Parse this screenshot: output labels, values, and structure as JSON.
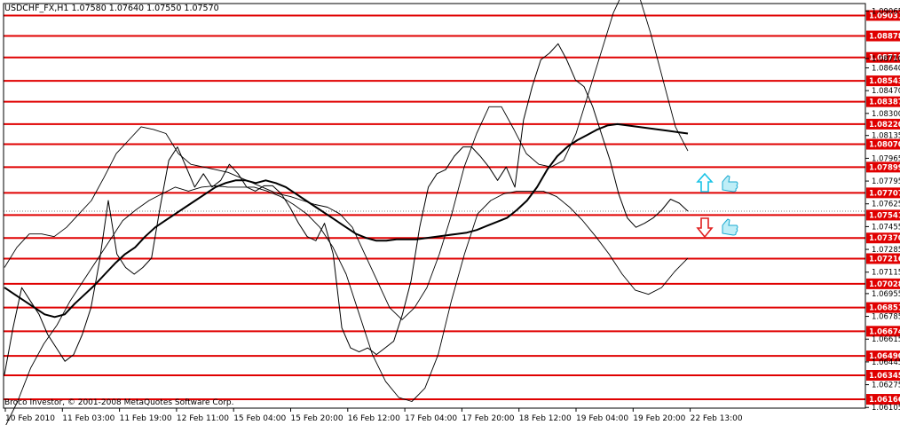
{
  "chart_data": {
    "type": "line",
    "title": "USDCHF_FX,H1  1.07580 1.07640 1.07550 1.07570",
    "watermark": "Broco Investor, © 2001-2008 MetaQuotes Software Corp.",
    "ylim": [
      1.061,
      1.0912
    ],
    "x_labels": [
      "10 Feb 2010",
      "11 Feb 03:00",
      "11 Feb 19:00",
      "12 Feb 11:00",
      "15 Feb 04:00",
      "15 Feb 20:00",
      "16 Feb 12:00",
      "17 Feb 04:00",
      "17 Feb 20:00",
      "18 Feb 12:00",
      "19 Feb 04:00",
      "19 Feb 20:00",
      "22 Feb 13:00"
    ],
    "y_ticks": [
      "1.09065",
      "1.08710",
      "1.08640",
      "1.08470",
      "1.08300",
      "1.08135",
      "1.07965",
      "1.07795",
      "1.07625",
      "1.07455",
      "1.07285",
      "1.07115",
      "1.06955",
      "1.06785",
      "1.06615",
      "1.06445",
      "1.06275",
      "1.06105"
    ],
    "levels": [
      {
        "label": "1.09031",
        "value": 1.09031
      },
      {
        "label": "1.08878",
        "value": 1.08878
      },
      {
        "label": "1.08718",
        "value": 1.08718
      },
      {
        "label": "1.08543",
        "value": 1.08543
      },
      {
        "label": "1.08387",
        "value": 1.08387
      },
      {
        "label": "1.08220",
        "value": 1.0822
      },
      {
        "label": "1.08070",
        "value": 1.0807
      },
      {
        "label": "1.07899",
        "value": 1.07899
      },
      {
        "label": "1.07707",
        "value": 1.07707
      },
      {
        "label": "1.07541",
        "value": 1.07541
      },
      {
        "label": "1.07370",
        "value": 1.0737
      },
      {
        "label": "1.07216",
        "value": 1.07216
      },
      {
        "label": "1.07028",
        "value": 1.07028
      },
      {
        "label": "1.06851",
        "value": 1.06851
      },
      {
        "label": "1.06674",
        "value": 1.06674
      },
      {
        "label": "1.06490",
        "value": 1.0649
      },
      {
        "label": "1.06345",
        "value": 1.06345
      },
      {
        "label": "1.06166",
        "value": 1.06166
      }
    ],
    "current_price": 1.0757,
    "series": [
      {
        "values": [
          1.0635,
          1.067,
          1.07,
          1.069,
          1.068,
          1.0665,
          1.0655,
          1.0645,
          1.065,
          1.0665,
          1.0685,
          1.072,
          1.0765,
          1.0725,
          1.0715,
          1.071,
          1.0715,
          1.0722,
          1.076,
          1.0795,
          1.0805,
          1.079,
          1.0775,
          1.0785,
          1.0775,
          1.078,
          1.0792,
          1.0785,
          1.0775,
          1.0772,
          1.0776,
          1.0776,
          1.077,
          1.076,
          1.0748,
          1.0738,
          1.0735,
          1.0748,
          1.0725,
          1.067,
          1.0655,
          1.0652,
          1.0655,
          1.065,
          1.0655,
          1.066,
          1.068,
          1.0705,
          1.0745,
          1.0775,
          1.0785,
          1.0788,
          1.0798,
          1.0805,
          1.0805,
          1.0798,
          1.079,
          1.078,
          1.079,
          1.0775,
          1.0825,
          1.085,
          1.087,
          1.0875,
          1.0882,
          1.087,
          1.0855,
          1.085,
          1.0835,
          1.0815,
          1.0795,
          1.077,
          1.0752,
          1.0745,
          1.0748,
          1.0752,
          1.0758,
          1.0766,
          1.0763,
          1.0757
        ]
      },
      {
        "values": [
          1.07,
          1.0695,
          1.069,
          1.0685,
          1.068,
          1.0678,
          1.068,
          1.0688,
          1.0695,
          1.0702,
          1.071,
          1.0718,
          1.0725,
          1.073,
          1.0738,
          1.0745,
          1.075,
          1.0755,
          1.076,
          1.0765,
          1.077,
          1.0775,
          1.0778,
          1.078,
          1.078,
          1.0778,
          1.078,
          1.0778,
          1.0775,
          1.077,
          1.0765,
          1.076,
          1.0755,
          1.075,
          1.0745,
          1.074,
          1.0737,
          1.0735,
          1.0735,
          1.0736,
          1.0736,
          1.0736,
          1.0737,
          1.0738,
          1.0739,
          1.074,
          1.0741,
          1.0743,
          1.0746,
          1.0749,
          1.0752,
          1.0758,
          1.0765,
          1.0775,
          1.0788,
          1.0798,
          1.0805,
          1.081,
          1.0814,
          1.0818,
          1.0821,
          1.0822,
          1.0821,
          1.082,
          1.0819,
          1.0818,
          1.0817,
          1.0816,
          1.0815
        ]
      },
      {
        "values": [
          1.0715,
          1.073,
          1.074,
          1.074,
          1.0738,
          1.0745,
          1.0755,
          1.0765,
          1.0782,
          1.08,
          1.081,
          1.082,
          1.0818,
          1.0815,
          1.08,
          1.0792,
          1.079,
          1.0788,
          1.0786,
          1.0782,
          1.0778,
          1.0774,
          1.077,
          1.0768,
          1.0765,
          1.0762,
          1.076,
          1.0755,
          1.0745,
          1.0725,
          1.0705,
          1.0685,
          1.0676,
          1.0685,
          1.07,
          1.0725,
          1.0755,
          1.079,
          1.0815,
          1.0835,
          1.0835,
          1.0818,
          1.08,
          1.0792,
          1.079,
          1.0795,
          1.0815,
          1.0845,
          1.0875,
          1.0905,
          1.0925,
          1.092,
          1.089,
          1.0855,
          1.082,
          1.0802
        ]
      },
      {
        "values": [
          1.0595,
          1.0615,
          1.064,
          1.0658,
          1.0672,
          1.069,
          1.0705,
          1.072,
          1.0735,
          1.075,
          1.0758,
          1.0765,
          1.077,
          1.0775,
          1.0772,
          1.0775,
          1.0776,
          1.0775,
          1.0775,
          1.0775,
          1.0772,
          1.0768,
          1.0762,
          1.0755,
          1.0745,
          1.073,
          1.071,
          1.068,
          1.065,
          1.063,
          1.0618,
          1.0615,
          1.0625,
          1.065,
          1.069,
          1.0725,
          1.0755,
          1.0765,
          1.077,
          1.0772,
          1.0772,
          1.0772,
          1.0768,
          1.076,
          1.075,
          1.0738,
          1.0725,
          1.071,
          1.0698,
          1.0695,
          1.07,
          1.0712,
          1.0722
        ]
      }
    ]
  }
}
